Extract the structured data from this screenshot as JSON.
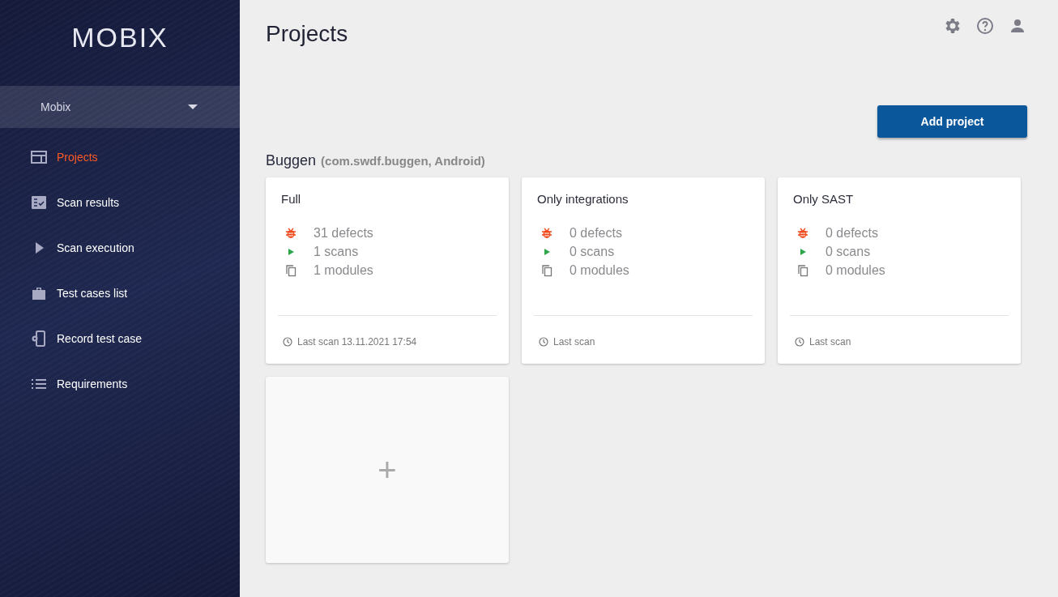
{
  "sidebar": {
    "logo": "MOBIX",
    "org_selector": {
      "value": "Mobix"
    },
    "items": [
      {
        "label": "Projects",
        "kind": "projects",
        "selected": true
      },
      {
        "label": "Scan results",
        "kind": "results",
        "selected": false
      },
      {
        "label": "Scan execution",
        "kind": "execution",
        "selected": false
      },
      {
        "label": "Test cases list",
        "kind": "cases",
        "selected": false
      },
      {
        "label": "Record test case",
        "kind": "record",
        "selected": false
      },
      {
        "label": "Requirements",
        "kind": "requirements",
        "selected": false
      }
    ]
  },
  "header": {
    "title": "Projects"
  },
  "add_button": "Add project",
  "group": {
    "name": "Buggen",
    "meta": "(com.swdf.buggen, Android)",
    "cards": [
      {
        "title": "Full",
        "stats": [
          {
            "kind": "defects",
            "text": "31 defects"
          },
          {
            "kind": "scans",
            "text": "1 scans"
          },
          {
            "kind": "modules",
            "text": "1 modules"
          }
        ],
        "last_scan": "Last scan 13.11.2021 17:54"
      },
      {
        "title": "Only integrations",
        "stats": [
          {
            "kind": "defects",
            "text": "0 defects"
          },
          {
            "kind": "scans",
            "text": "0 scans"
          },
          {
            "kind": "modules",
            "text": "0 modules"
          }
        ],
        "last_scan": "Last scan"
      },
      {
        "title": "Only SAST",
        "stats": [
          {
            "kind": "defects",
            "text": "0 defects"
          },
          {
            "kind": "scans",
            "text": "0 scans"
          },
          {
            "kind": "modules",
            "text": "0 modules"
          }
        ],
        "last_scan": "Last scan"
      }
    ],
    "add_card": "+"
  }
}
